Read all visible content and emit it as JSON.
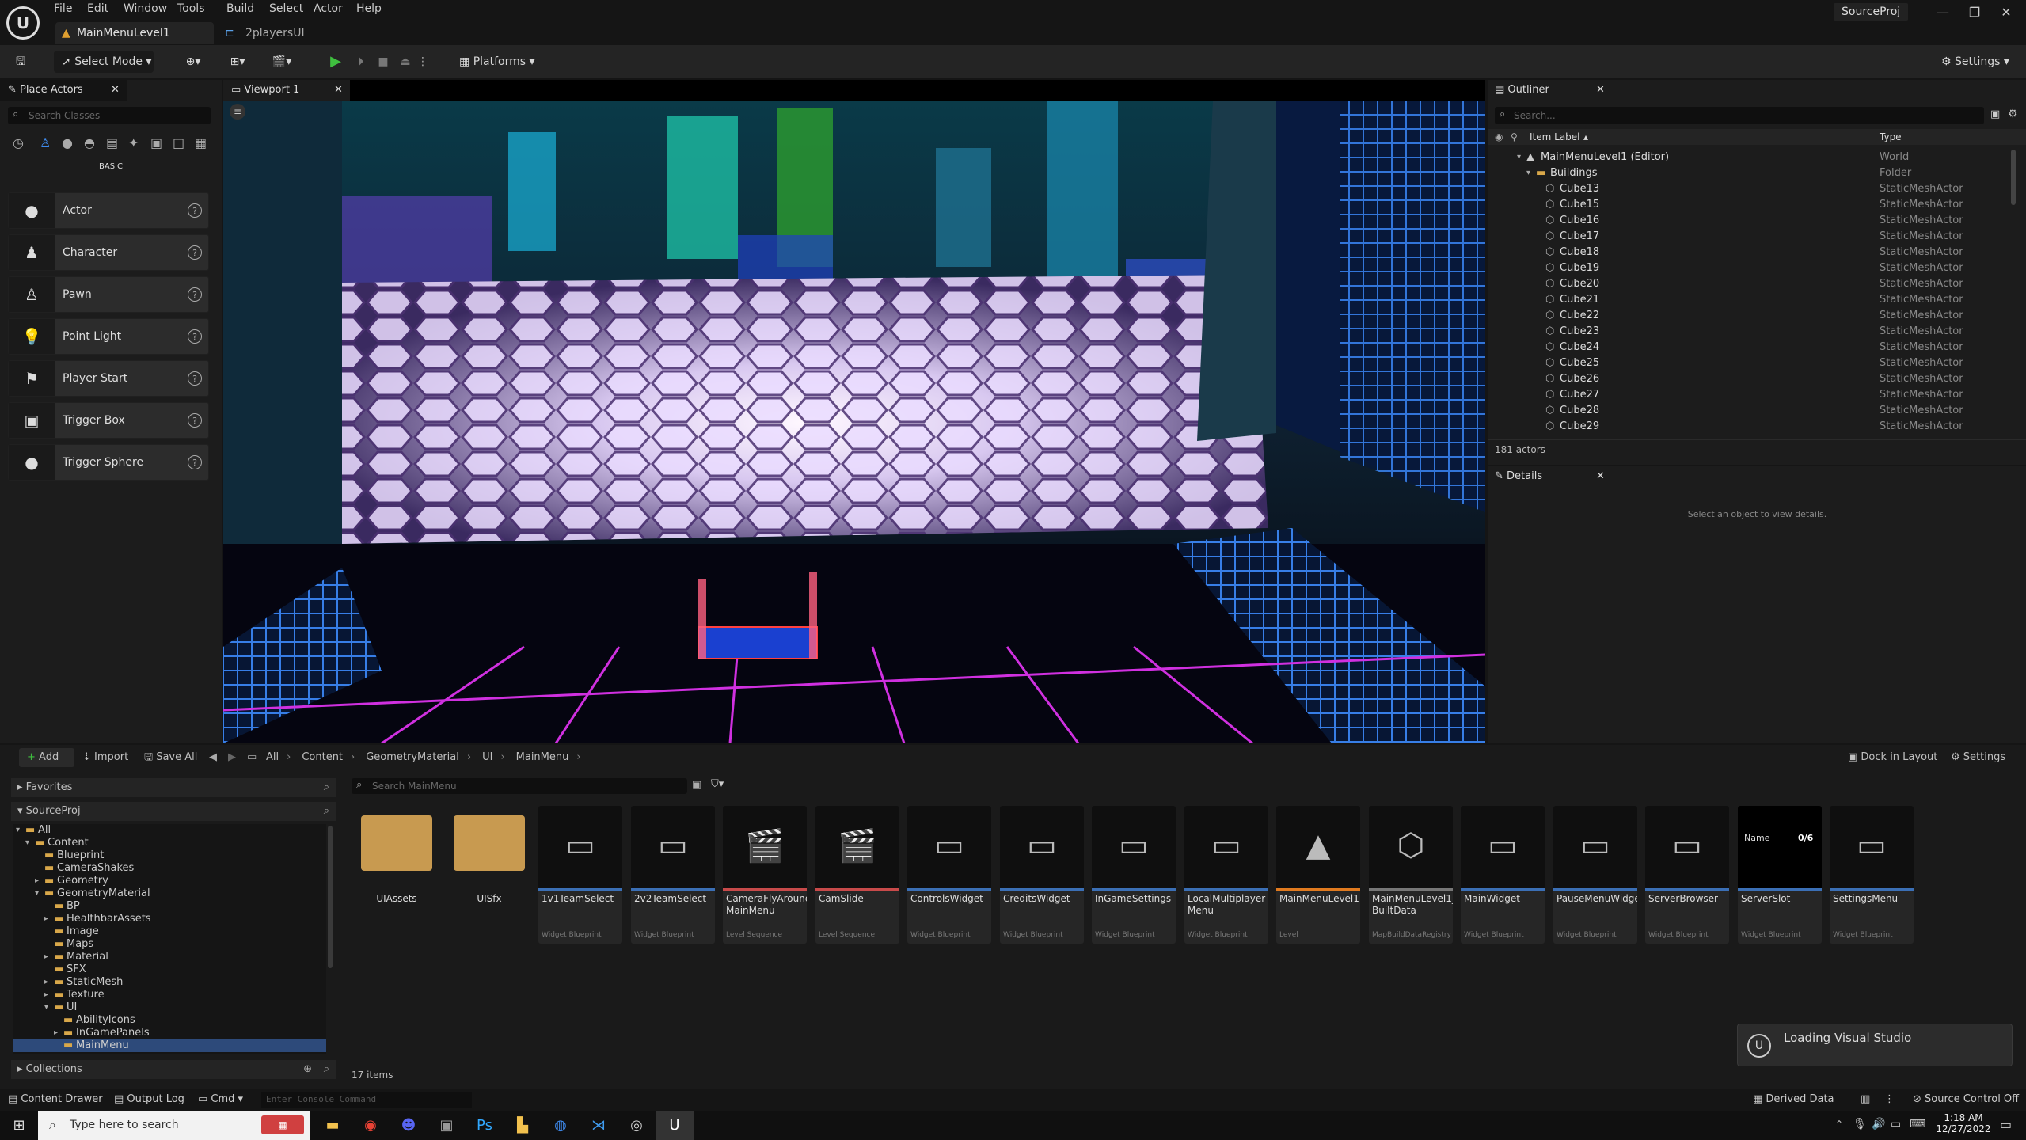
{
  "menu": [
    "File",
    "Edit",
    "Window",
    "Tools",
    "Build",
    "Select",
    "Actor",
    "Help"
  ],
  "tabs": {
    "level": "MainMenuLevel1",
    "ui": "2playersUI"
  },
  "project_name": "SourceProj",
  "toolbar": {
    "select_mode": "Select Mode",
    "platforms": "Platforms",
    "settings": "Settings"
  },
  "place_actors": {
    "title": "Place Actors",
    "search_placeholder": "Search Classes",
    "category": "BASIC",
    "items": [
      {
        "label": "Actor",
        "icon": "sphere-icon"
      },
      {
        "label": "Character",
        "icon": "character-icon"
      },
      {
        "label": "Pawn",
        "icon": "pawn-icon"
      },
      {
        "label": "Point Light",
        "icon": "bulb-icon"
      },
      {
        "label": "Player Start",
        "icon": "flag-icon"
      },
      {
        "label": "Trigger Box",
        "icon": "box-icon"
      },
      {
        "label": "Trigger Sphere",
        "icon": "sphere-icon"
      }
    ]
  },
  "viewport": {
    "tab": "Viewport 1"
  },
  "outliner": {
    "title": "Outliner",
    "search_placeholder": "Search...",
    "col_label": "Item Label",
    "col_type": "Type",
    "rows": [
      {
        "label": "MainMenuLevel1 (Editor)",
        "type": "World",
        "indent": 0
      },
      {
        "label": "Buildings",
        "type": "Folder",
        "indent": 1
      },
      {
        "label": "Cube13",
        "type": "StaticMeshActor",
        "indent": 2
      },
      {
        "label": "Cube15",
        "type": "StaticMeshActor",
        "indent": 2
      },
      {
        "label": "Cube16",
        "type": "StaticMeshActor",
        "indent": 2
      },
      {
        "label": "Cube17",
        "type": "StaticMeshActor",
        "indent": 2
      },
      {
        "label": "Cube18",
        "type": "StaticMeshActor",
        "indent": 2
      },
      {
        "label": "Cube19",
        "type": "StaticMeshActor",
        "indent": 2
      },
      {
        "label": "Cube20",
        "type": "StaticMeshActor",
        "indent": 2
      },
      {
        "label": "Cube21",
        "type": "StaticMeshActor",
        "indent": 2
      },
      {
        "label": "Cube22",
        "type": "StaticMeshActor",
        "indent": 2
      },
      {
        "label": "Cube23",
        "type": "StaticMeshActor",
        "indent": 2
      },
      {
        "label": "Cube24",
        "type": "StaticMeshActor",
        "indent": 2
      },
      {
        "label": "Cube25",
        "type": "StaticMeshActor",
        "indent": 2
      },
      {
        "label": "Cube26",
        "type": "StaticMeshActor",
        "indent": 2
      },
      {
        "label": "Cube27",
        "type": "StaticMeshActor",
        "indent": 2
      },
      {
        "label": "Cube28",
        "type": "StaticMeshActor",
        "indent": 2
      },
      {
        "label": "Cube29",
        "type": "StaticMeshActor",
        "indent": 2
      }
    ],
    "count": "181 actors"
  },
  "details": {
    "title": "Details",
    "empty": "Select an object to view details."
  },
  "content": {
    "add": "Add",
    "import": "Import",
    "save_all": "Save All",
    "breadcrumb": [
      "All",
      "Content",
      "GeometryMaterial",
      "UI",
      "MainMenu"
    ],
    "dock": "Dock in Layout",
    "settings": "Settings",
    "favorites": "Favorites",
    "project": "SourceProj",
    "collections": "Collections",
    "search_placeholder": "Search MainMenu",
    "tree": [
      {
        "label": "All",
        "depth": 0,
        "open": true
      },
      {
        "label": "Content",
        "depth": 1,
        "open": true
      },
      {
        "label": "Blueprint",
        "depth": 2
      },
      {
        "label": "CameraShakes",
        "depth": 2
      },
      {
        "label": "Geometry",
        "depth": 2,
        "closed": true
      },
      {
        "label": "GeometryMaterial",
        "depth": 2,
        "open": true
      },
      {
        "label": "BP",
        "depth": 3
      },
      {
        "label": "HealthbarAssets",
        "depth": 3,
        "closed": true
      },
      {
        "label": "Image",
        "depth": 3
      },
      {
        "label": "Maps",
        "depth": 3
      },
      {
        "label": "Material",
        "depth": 3,
        "closed": true
      },
      {
        "label": "SFX",
        "depth": 3
      },
      {
        "label": "StaticMesh",
        "depth": 3,
        "closed": true
      },
      {
        "label": "Texture",
        "depth": 3,
        "closed": true
      },
      {
        "label": "UI",
        "depth": 3,
        "open": true
      },
      {
        "label": "AbilityIcons",
        "depth": 4
      },
      {
        "label": "InGamePanels",
        "depth": 4,
        "closed": true
      },
      {
        "label": "MainMenu",
        "depth": 4,
        "selected": true
      }
    ],
    "folders": [
      "UIAssets",
      "UISfx"
    ],
    "assets": [
      {
        "name": "1v1TeamSelect",
        "type": "Widget Blueprint",
        "bar": "#3b6fb5"
      },
      {
        "name": "2v2TeamSelect",
        "type": "Widget Blueprint",
        "bar": "#3b6fb5"
      },
      {
        "name": "CameraFlyAround MainMenu",
        "type": "Level Sequence",
        "bar": "#c84a4a"
      },
      {
        "name": "CamSlide",
        "type": "Level Sequence",
        "bar": "#c84a4a"
      },
      {
        "name": "ControlsWidget",
        "type": "Widget Blueprint",
        "bar": "#3b6fb5"
      },
      {
        "name": "CreditsWidget",
        "type": "Widget Blueprint",
        "bar": "#3b6fb5"
      },
      {
        "name": "InGameSettings",
        "type": "Widget Blueprint",
        "bar": "#3b6fb5"
      },
      {
        "name": "LocalMultiplayer Menu",
        "type": "Widget Blueprint",
        "bar": "#3b6fb5"
      },
      {
        "name": "MainMenuLevel1",
        "type": "Level",
        "bar": "#e07a1f"
      },
      {
        "name": "MainMenuLevel1_ BuiltData",
        "type": "MapBuildDataRegistry",
        "bar": "#777"
      },
      {
        "name": "MainWidget",
        "type": "Widget Blueprint",
        "bar": "#3b6fb5"
      },
      {
        "name": "PauseMenuWidget",
        "type": "Widget Blueprint",
        "bar": "#3b6fb5"
      },
      {
        "name": "ServerBrowser",
        "type": "Widget Blueprint",
        "bar": "#3b6fb5"
      },
      {
        "name": "ServerSlot",
        "type": "Widget Blueprint",
        "bar": "#3b6fb5",
        "thumb_name": "Name",
        "thumb_count": "0/6"
      },
      {
        "name": "SettingsMenu",
        "type": "Widget Blueprint",
        "bar": "#3b6fb5"
      }
    ],
    "item_count": "17 items",
    "toast": "Loading Visual Studio"
  },
  "status": {
    "drawer": "Content Drawer",
    "output": "Output Log",
    "cmd": "Cmd",
    "console_placeholder": "Enter Console Command",
    "derived": "Derived Data",
    "source": "Source Control Off"
  },
  "taskbar": {
    "search_placeholder": "Type here to search",
    "time": "1:18 AM",
    "date": "12/27/2022"
  }
}
